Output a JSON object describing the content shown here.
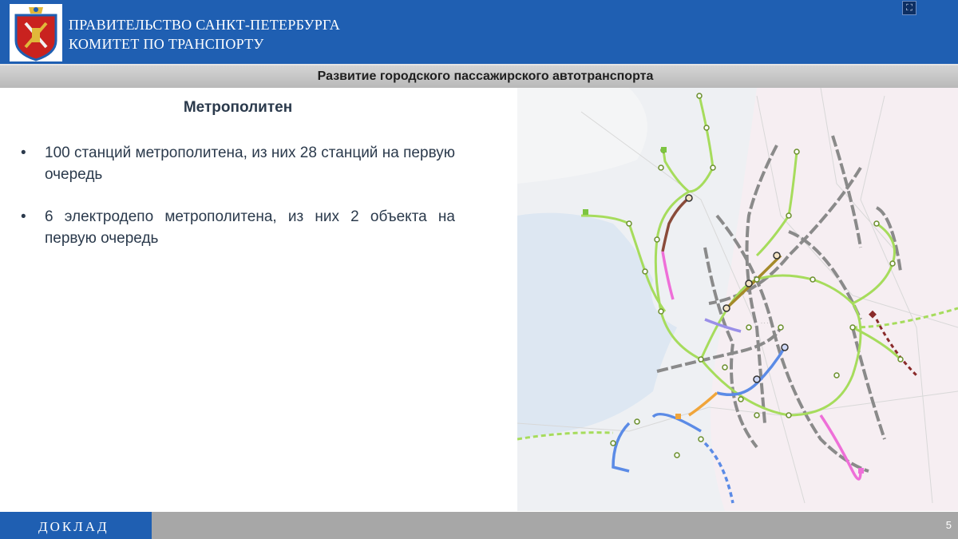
{
  "header": {
    "org_line1": "ПРАВИТЕЛЬСТВО САНКТ-ПЕТЕРБУРГА",
    "org_line2": "КОМИТЕТ ПО ТРАНСПОРТУ",
    "background_color": "#1f5fb2",
    "fullscreen_icon": "fullscreen-icon"
  },
  "slide": {
    "title": "Развитие городского пассажирского автотранспорта",
    "section_title": "Метрополитен",
    "bullets": [
      {
        "marker": "•",
        "text": "100 станций метрополитена, из них 28 станций на первую очередь"
      },
      {
        "marker": "•",
        "text": "6 электродепо метрополитена, из них  2 объекта на первую очередь"
      }
    ]
  },
  "map": {
    "description_icon": "metro-scheme-map",
    "line_colors": {
      "existing": "#8a8a8a",
      "planned_green": "#a6dc5c",
      "brown": "#8a4b3a",
      "olive": "#a58a2a",
      "pink": "#ee6fd8",
      "purple": "#9a8fe8",
      "blue": "#5b8be6",
      "orange": "#f0a53a",
      "dark_red": "#8a2a2a"
    }
  },
  "footer": {
    "label": "ДОКЛАД",
    "page_number": "5"
  }
}
